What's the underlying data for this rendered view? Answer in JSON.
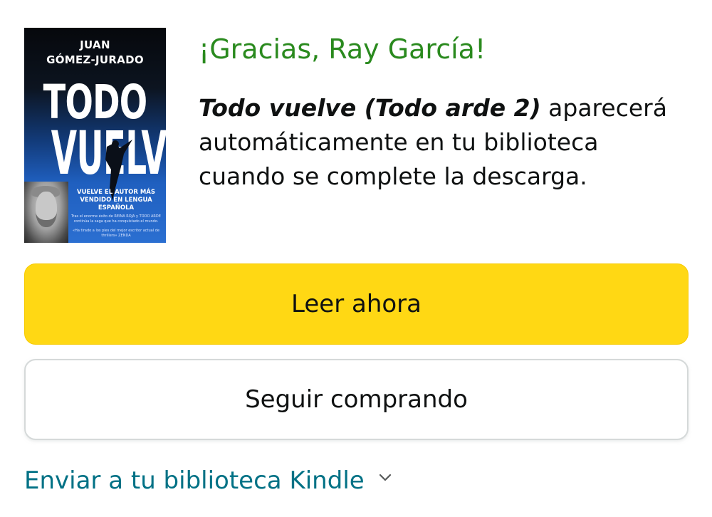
{
  "cover": {
    "author_line1": "JUAN",
    "author_line2": "GÓMEZ-JURADO",
    "title_line1": "TODO",
    "title_line2": "VUELVE",
    "tagline": "VUELVE EL AUTOR MÁS VENDIDO EN LENGUA ESPAÑOLA",
    "fine_print1": "Tras el enorme éxito de REINA ROJA y TODO ARDE continúa la saga que ha conquistado el mundo.",
    "fine_print2": "«Ha tirado a los pies del mejor escritor actual de thrillers» ZENDA"
  },
  "confirmation": {
    "thanks": "¡Gracias, Ray García!",
    "book_title": "Todo vuelve (Todo arde 2)",
    "message": " aparecerá automáticamente en tu biblioteca cuando se complete la descarga."
  },
  "actions": {
    "read_now": "Leer ahora",
    "continue_shopping": "Seguir comprando",
    "send_to_library": "Enviar a tu biblioteca Kindle"
  },
  "colors": {
    "thanks_green": "#2a8a1e",
    "primary_button": "#ffd814",
    "link_teal": "#007185"
  },
  "icons": {
    "send_dropdown": "chevron-down-icon"
  }
}
